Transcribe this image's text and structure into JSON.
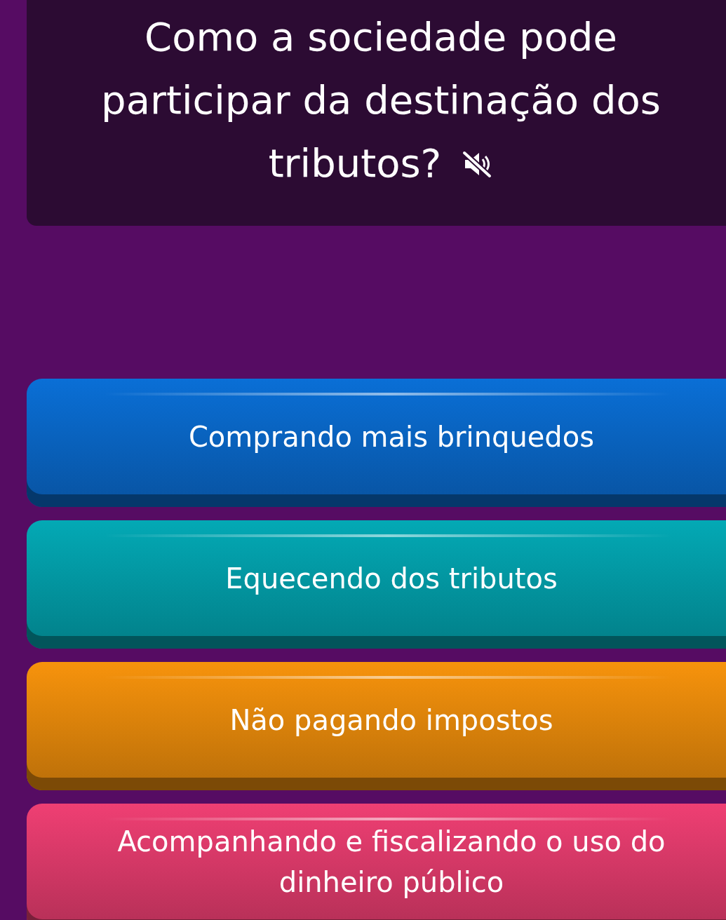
{
  "question": {
    "text": "Como a sociedade pode participar da destinação dos tributos?",
    "audio_muted": true
  },
  "answers": [
    {
      "label": "Comprando mais brinquedos",
      "color": "#0a6fd6"
    },
    {
      "label": "Equecendo dos tributos",
      "color": "#03a9b5"
    },
    {
      "label": "Não pagando impostos",
      "color": "#f7930c"
    },
    {
      "label": "Acompanhando e fiscalizando o uso do dinheiro público",
      "color": "#ef3f73"
    }
  ]
}
